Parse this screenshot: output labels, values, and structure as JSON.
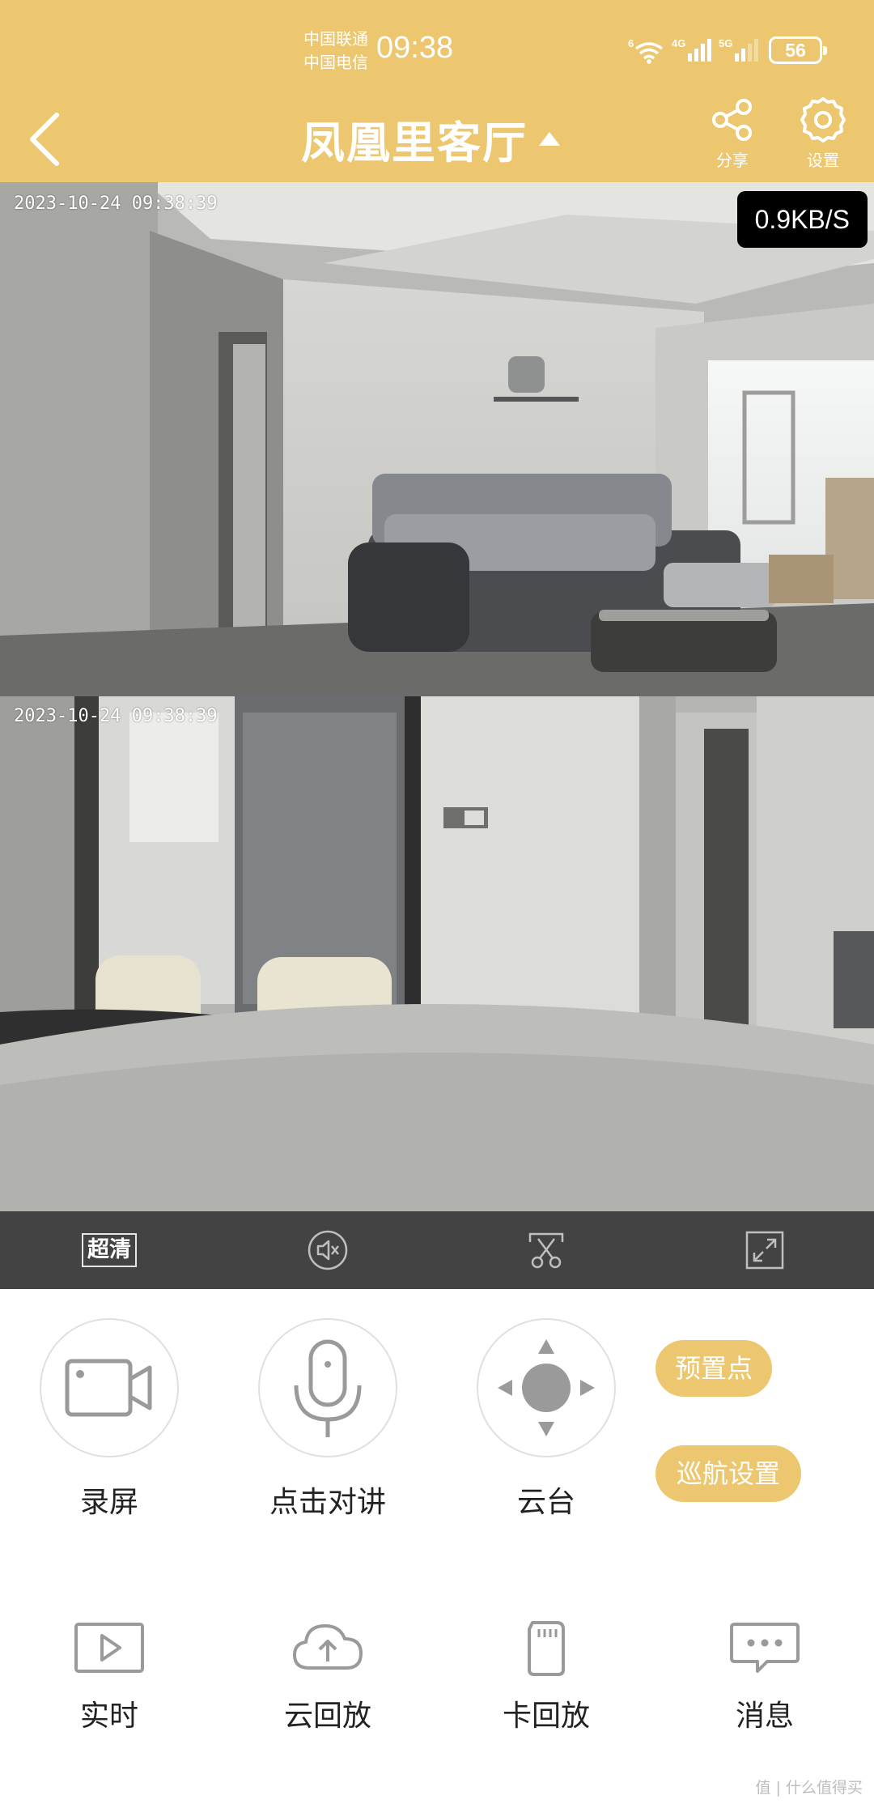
{
  "status_bar": {
    "carrier_1": "中国联通",
    "carrier_2": "中国电信",
    "time": "09:38",
    "wifi_label": "6",
    "net_1": "4G",
    "net_2": "5G",
    "battery": "56",
    "icons": [
      "wifi-icon",
      "signal-4g-icon",
      "signal-5g-icon",
      "battery-icon"
    ]
  },
  "header": {
    "title": "凤凰里客厅",
    "share_label": "分享",
    "settings_label": "设置",
    "icons": [
      "back-arrow-icon",
      "dropdown-caret-icon",
      "share-icon",
      "gear-icon"
    ]
  },
  "video": {
    "top_timestamp": "2023-10-24  09:38:39",
    "bottom_timestamp": "2023-10-24  09:38:39",
    "bitrate": "0.9KB/S"
  },
  "control_bar": {
    "quality_label": "超清",
    "icons": [
      "mute-icon",
      "screenshot-scissors-icon",
      "fullscreen-icon"
    ]
  },
  "actions": {
    "record_label": "录屏",
    "talk_label": "点击对讲",
    "ptz_label": "云台",
    "preset_label": "预置点",
    "cruise_label": "巡航设置",
    "icons": [
      "video-camera-icon",
      "microphone-icon",
      "ptz-dpad-icon"
    ]
  },
  "bottom_nav": [
    {
      "label": "实时",
      "icon": "play-icon"
    },
    {
      "label": "云回放",
      "icon": "cloud-upload-icon"
    },
    {
      "label": "卡回放",
      "icon": "sd-card-icon"
    },
    {
      "label": "消息",
      "icon": "message-icon"
    }
  ],
  "watermark": "值 | 什么值得买",
  "colors": {
    "accent": "#ecc76f",
    "control_bar": "#434343",
    "icon_gray": "#9a9a9a"
  }
}
